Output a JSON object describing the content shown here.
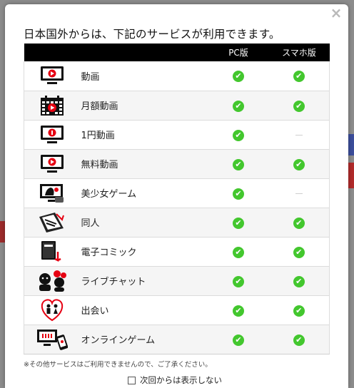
{
  "modal": {
    "close_label": "×",
    "title": "日本国外からは、下記のサービスが利用できます。",
    "columns": {
      "pc": "PC版",
      "smartphone": "スマホ版"
    },
    "services": [
      {
        "name": "動画",
        "icon": "video-monitor-icon",
        "pc": "check",
        "smartphone": "check"
      },
      {
        "name": "月額動画",
        "icon": "calendar-video-icon",
        "pc": "check",
        "smartphone": "check"
      },
      {
        "name": "1円動画",
        "icon": "one-yen-monitor-icon",
        "pc": "check",
        "smartphone": "dash"
      },
      {
        "name": "無料動画",
        "icon": "video-monitor-icon",
        "pc": "check",
        "smartphone": "check"
      },
      {
        "name": "美少女ゲーム",
        "icon": "bishoujo-game-icon",
        "pc": "check",
        "smartphone": "dash"
      },
      {
        "name": "同人",
        "icon": "doujin-book-icon",
        "pc": "check",
        "smartphone": "check"
      },
      {
        "name": "電子コミック",
        "icon": "ebook-comic-icon",
        "pc": "check",
        "smartphone": "check"
      },
      {
        "name": "ライブチャット",
        "icon": "live-chat-icon",
        "pc": "check",
        "smartphone": "check"
      },
      {
        "name": "出会い",
        "icon": "dating-heart-icon",
        "pc": "check",
        "smartphone": "check"
      },
      {
        "name": "オンラインゲーム",
        "icon": "online-game-devices-icon",
        "pc": "check",
        "smartphone": "check"
      }
    ],
    "check_glyph": "✔",
    "note": "※その他サービスはご利用できませんので、ご了承ください。",
    "dont_show_label": "次回からは表示しない"
  },
  "colors": {
    "header_bg": "#000000",
    "check_green": "#43c72e",
    "accent_red": "#e60012"
  }
}
